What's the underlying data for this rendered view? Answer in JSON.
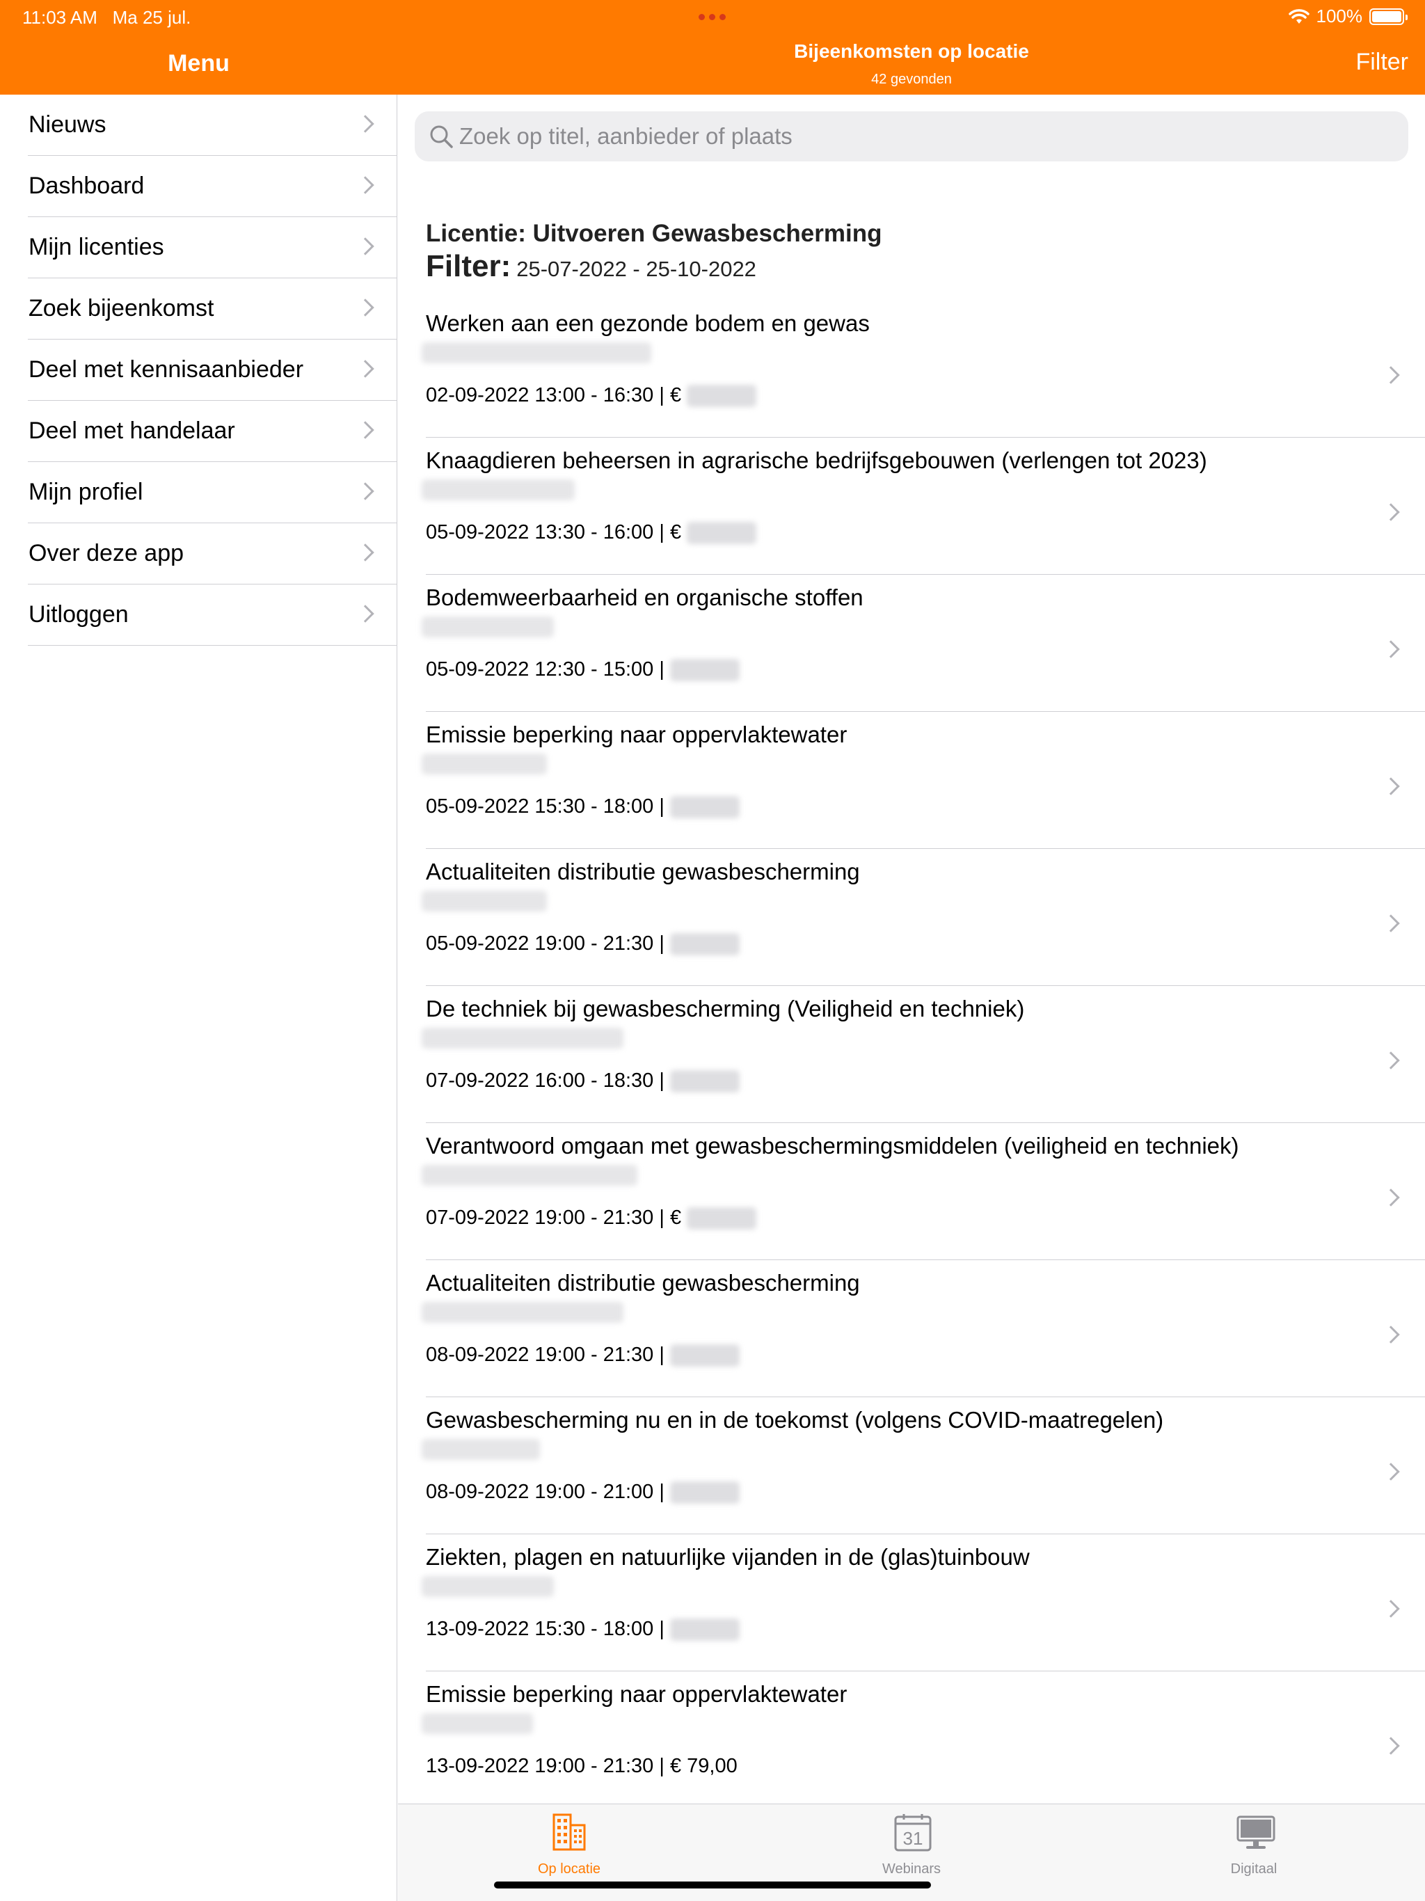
{
  "status_bar": {
    "time": "11:03 AM",
    "date": "Ma 25 jul.",
    "battery": "100%"
  },
  "sidebar": {
    "title": "Menu",
    "items": [
      {
        "label": "Nieuws"
      },
      {
        "label": "Dashboard"
      },
      {
        "label": "Mijn licenties"
      },
      {
        "label": "Zoek bijeenkomst"
      },
      {
        "label": "Deel met kennisaanbieder"
      },
      {
        "label": "Deel met handelaar"
      },
      {
        "label": "Mijn profiel"
      },
      {
        "label": "Over deze app"
      },
      {
        "label": "Uitloggen"
      }
    ]
  },
  "header": {
    "title": "Bijeenkomsten op locatie",
    "subtitle": "42 gevonden",
    "filter_label": "Filter"
  },
  "search": {
    "placeholder": "Zoek op titel, aanbieder of plaats",
    "value": ""
  },
  "licence_heading": "Licentie: Uitvoeren Gewasbescherming",
  "filter_heading": {
    "label": "Filter:",
    "range": "25-07-2022 - 25-10-2022"
  },
  "events": [
    {
      "title": "Werken aan een gezonde bodem en gewas",
      "meta": "02-09-2022 13:00 - 16:30 | €",
      "price": ""
    },
    {
      "title": "Knaagdieren beheersen in agrarische bedrijfsgebouwen (verlengen tot 2023)",
      "meta": "05-09-2022 13:30 - 16:00 | €",
      "price": ""
    },
    {
      "title": "Bodemweerbaarheid en organische stoffen",
      "meta": "05-09-2022 12:30 - 15:00 |",
      "price": ""
    },
    {
      "title": "Emissie beperking naar oppervlaktewater",
      "meta": "05-09-2022 15:30 - 18:00 |",
      "price": ""
    },
    {
      "title": "Actualiteiten distributie gewasbescherming",
      "meta": "05-09-2022 19:00 - 21:30 |",
      "price": ""
    },
    {
      "title": "De techniek bij gewasbescherming (Veiligheid en techniek)",
      "meta": "07-09-2022 16:00 - 18:30 |",
      "price": ""
    },
    {
      "title": "Verantwoord omgaan met gewasbeschermingsmiddelen (veiligheid en techniek)",
      "meta": "07-09-2022 19:00 - 21:30 | €",
      "price": ""
    },
    {
      "title": "Actualiteiten distributie gewasbescherming",
      "meta": "08-09-2022 19:00 - 21:30 |",
      "price": ""
    },
    {
      "title": "Gewasbescherming nu en in de toekomst (volgens COVID-maatregelen)",
      "meta": "08-09-2022 19:00 - 21:00 |",
      "price": ""
    },
    {
      "title": "Ziekten, plagen en natuurlijke vijanden in de (glas)tuinbouw",
      "meta": "13-09-2022 15:30 - 18:00 |",
      "price": ""
    },
    {
      "title": "Emissie beperking naar oppervlaktewater",
      "meta": "13-09-2022 19:00 - 21:30 | € 79,00",
      "price": "visible"
    }
  ],
  "tabs": [
    {
      "label": "Op locatie",
      "icon": "building-icon",
      "active": true
    },
    {
      "label": "Webinars",
      "icon": "calendar-icon",
      "calendar_day": "31"
    },
    {
      "label": "Digitaal",
      "icon": "monitor-icon"
    }
  ],
  "colors": {
    "accent": "#FF7A00",
    "separator": "#cfcfd4",
    "inactive": "#8e8e93"
  }
}
